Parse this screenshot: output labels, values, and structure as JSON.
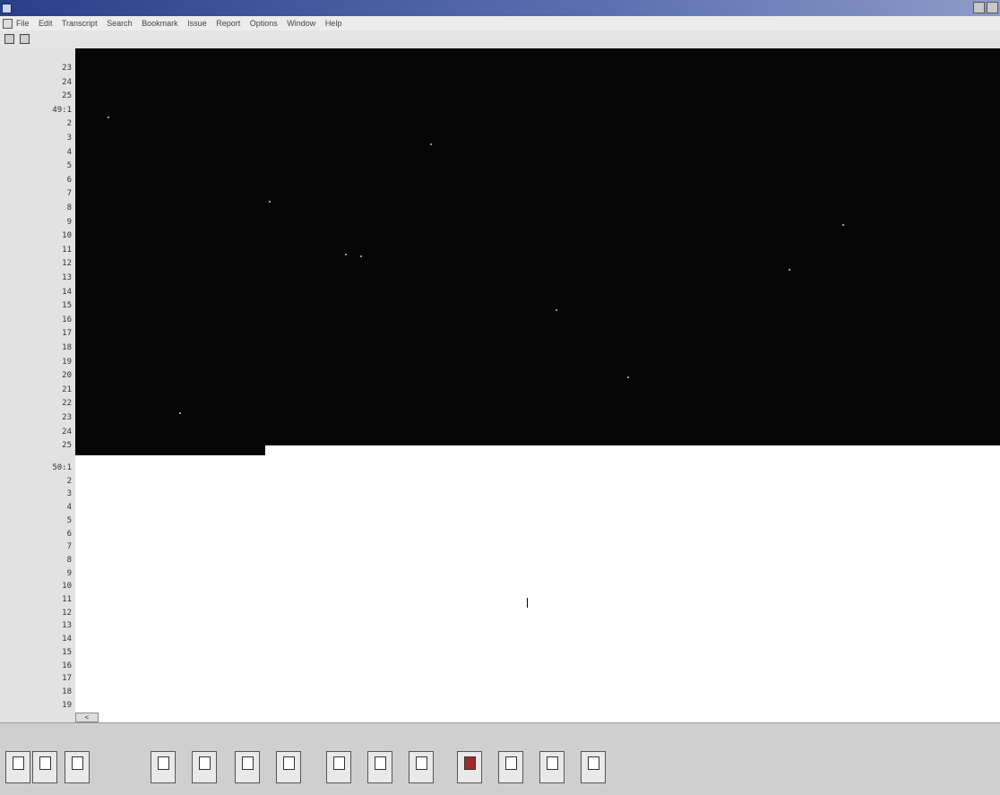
{
  "window": {
    "title": "",
    "controls": {
      "minimize": "",
      "close": ""
    }
  },
  "menubar": {
    "items": [
      "File",
      "Edit",
      "Transcript",
      "Search",
      "Bookmark",
      "Issue",
      "Report",
      "Options",
      "Window",
      "Help"
    ]
  },
  "toolbar_top": {
    "buttons": [
      {
        "icon": "save-icon"
      },
      {
        "icon": "flag-icon"
      }
    ]
  },
  "upper_pane": {
    "line_numbers": [
      "23",
      "24",
      "25",
      "49:1",
      "2",
      "3",
      "4",
      "5",
      "6",
      "7",
      "8",
      "9",
      "10",
      "11",
      "12",
      "13",
      "14",
      "15",
      "16",
      "17",
      "18",
      "19",
      "20",
      "21",
      "22",
      "23",
      "24",
      "25"
    ]
  },
  "lower_pane": {
    "lines": [
      {
        "page_line": "50:1",
        "time": "",
        "text": ""
      },
      {
        "page_line": "2",
        "time": "",
        "text": ""
      },
      {
        "page_line": "3",
        "time": "",
        "text": ""
      },
      {
        "page_line": "4",
        "time": "",
        "text": ""
      },
      {
        "page_line": "5",
        "time": "",
        "text": ""
      },
      {
        "page_line": "6",
        "time": "",
        "text": ""
      },
      {
        "page_line": "7",
        "time": "",
        "text": ""
      },
      {
        "page_line": "8",
        "time": "",
        "text": ""
      },
      {
        "page_line": "9",
        "time": "",
        "text": ""
      },
      {
        "page_line": "10",
        "time": "",
        "text": ""
      },
      {
        "page_line": "11",
        "time": "",
        "text": ""
      },
      {
        "page_line": "12",
        "time": "",
        "text": ""
      },
      {
        "page_line": "13",
        "time": "",
        "text": ""
      },
      {
        "page_line": "14",
        "time": "",
        "text": ""
      },
      {
        "page_line": "15",
        "time": "",
        "text": ""
      },
      {
        "page_line": "16",
        "time": "",
        "text": ""
      },
      {
        "page_line": "17",
        "time": "",
        "text": ""
      },
      {
        "page_line": "18",
        "time": "",
        "text": ""
      },
      {
        "page_line": "19",
        "time": "",
        "text": ""
      }
    ]
  },
  "hscroll": {
    "arrow": "<"
  },
  "bottom_toolbar": {
    "buttons": [
      {
        "icon": "document-icon",
        "label": ""
      },
      {
        "icon": "user-icon",
        "label": ""
      },
      {
        "icon": "user-icon",
        "label": ""
      },
      {
        "icon": "search-icon",
        "label": ""
      },
      {
        "icon": "search-icon",
        "label": ""
      },
      {
        "icon": "search-icon",
        "label": ""
      },
      {
        "icon": "search-icon",
        "label": ""
      },
      {
        "icon": "document-icon",
        "label": ""
      },
      {
        "icon": "search-icon",
        "label": ""
      },
      {
        "icon": "user-icon",
        "label": ""
      },
      {
        "icon": "stamp-icon",
        "label": ""
      },
      {
        "icon": "link-icon",
        "label": ""
      },
      {
        "icon": "tag-icon",
        "label": ""
      },
      {
        "icon": "pin-icon",
        "label": ""
      }
    ]
  },
  "colors": {
    "titlebar": "#2a3f8a",
    "upper_pane_bg": "#050505",
    "lower_pane_bg": "#ffffff",
    "chrome": "#d6d6d6"
  }
}
